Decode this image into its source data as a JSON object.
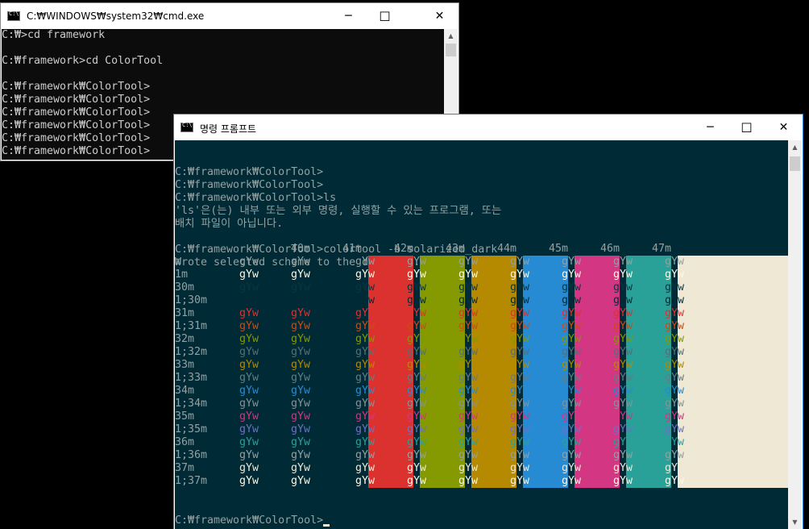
{
  "colors": {
    "solarized_bg": "#002b36",
    "solarized_fg": "#93a1a1",
    "legacy_bg": "#0c0c0c",
    "legacy_fg": "#cccccc"
  },
  "win1": {
    "title": "C:₩WINDOWS₩system32₩cmd.exe",
    "minimize": "─",
    "maximize": "☐",
    "close": "✕",
    "lines": [
      "C:₩>cd framework",
      "",
      "C:₩framework>cd ColorTool",
      "",
      "C:₩framework₩ColorTool>",
      "C:₩framework₩ColorTool>",
      "C:₩framework₩ColorTool>",
      "C:₩framework₩ColorTool>",
      "C:₩framework₩ColorTool>",
      "C:₩framework₩ColorTool>"
    ]
  },
  "win2": {
    "title": "명령 프롬프트",
    "minimize": "─",
    "maximize": "☐",
    "close": "✕",
    "lines": [
      "C:₩framework₩ColorTool>",
      "C:₩framework₩ColorTool>",
      "C:₩framework₩ColorTool>ls",
      "'ls'은(는) 내부 또는 외부 명령, 실행할 수 있는 프로그램, 또는",
      "배치 파일이 아닙니다.",
      "",
      "C:₩framework₩ColorTool>colortool -b solarized_dark",
      "Wrote selected scheme to the defaults."
    ],
    "table": {
      "header": [
        "40m",
        "41m",
        "42m",
        "43m",
        "44m",
        "45m",
        "46m",
        "47m"
      ],
      "row_labels": [
        "m",
        "1m",
        "30m",
        "1;30m",
        "31m",
        "1;31m",
        "32m",
        "1;32m",
        "33m",
        "1;33m",
        "34m",
        "1;34m",
        "35m",
        "1;35m",
        "36m",
        "1;36m",
        "37m",
        "1;37m"
      ],
      "sample": "gYw",
      "palette": {
        "default": "#93a1a1",
        "black": "#073642",
        "red": "#dc322f",
        "green": "#859900",
        "yellow": "#b58900",
        "blue": "#268bd2",
        "magenta": "#d33682",
        "cyan": "#2aa198",
        "white": "#eee8d5",
        "bright_black": "#002b36",
        "bright_red": "#cb4b16",
        "bright_green": "#586e75",
        "bright_yellow": "#657b83",
        "bright_blue": "#839496",
        "bright_magenta": "#6c71c4",
        "bright_cyan": "#93a1a1",
        "bright_white": "#fdf6e3"
      },
      "bg_colors": [
        "",
        "#dc322f",
        "#859900",
        "#b58900",
        "#268bd2",
        "#d33682",
        "#2aa198",
        "#eee8d5"
      ],
      "fg_colors": [
        "#93a1a1",
        "#fdf6e3",
        "#073642",
        "#002b36",
        "#dc322f",
        "#cb4b16",
        "#859900",
        "#586e75",
        "#b58900",
        "#657b83",
        "#268bd2",
        "#839496",
        "#d33682",
        "#6c71c4",
        "#2aa198",
        "#93a1a1",
        "#eee8d5",
        "#fdf6e3"
      ]
    },
    "prompt": "C:₩framework₩ColorTool>"
  }
}
